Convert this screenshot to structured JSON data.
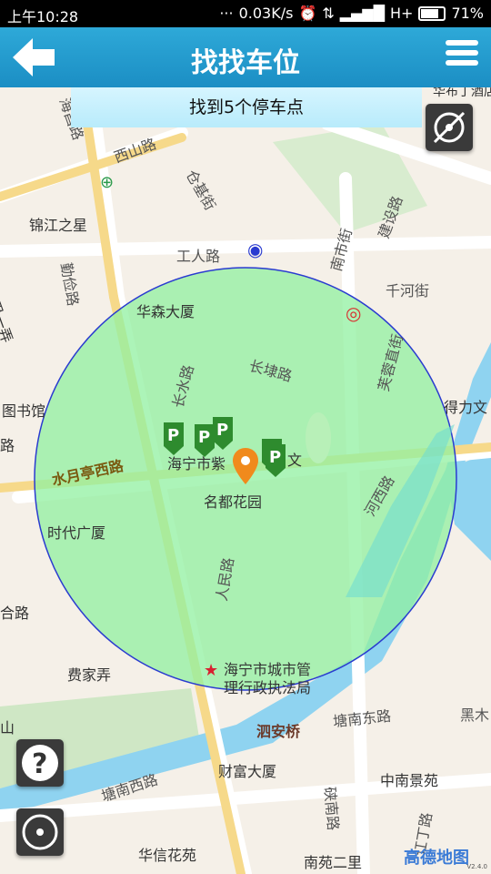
{
  "status": {
    "time": "上午10:28",
    "speed": "0.03K/s",
    "network": "H+",
    "battery": "71%",
    "battery_level": 0.71
  },
  "header": {
    "title": "找找车位"
  },
  "banner": {
    "text": "找到5个停车点"
  },
  "map_labels": {
    "jinjiang": "锦江之星",
    "huasen": "华森大厦",
    "library": "图书馆",
    "shidai": "时代广厦",
    "mingdu": "名都花园",
    "haining_zi": "海宁市紫",
    "wen": "文",
    "chengguan_1": "海宁市城市管",
    "chengguan_2": "理行政执法局",
    "delijwen": "得力文",
    "huafu": "华布丁酒店",
    "caifu": "财富大厦",
    "zhongnan": "中南景苑",
    "huaxin": "华信花苑",
    "nanyuan": "南苑二里",
    "fei": "费家弄",
    "siqiao": "泗安桥",
    "shan": "山",
    "hmu": "合路",
    "lu": "路",
    "yongfu": "永福里一弄"
  },
  "road_labels": {
    "xishan": "西山路",
    "haichang": "海昌路",
    "cangji": "仓基街",
    "jianshe": "建设路",
    "gongren": "工人路",
    "nanshi": "南市街",
    "qianhe": "千河街",
    "qinjian": "勤俭路",
    "changdi": "长埭路",
    "changshui": "长水路",
    "furong": "芙蓉直街",
    "shuiyue": "水月亭西路",
    "hexi": "河西路",
    "renmin": "人民路",
    "tangnan_e": "塘南东路",
    "tangnan_w": "塘南西路",
    "tingnan": "硖南路",
    "heimu": "黑木",
    "jiading": "讧丁路"
  },
  "parking": {
    "icon": "parking-pin-icon",
    "count": 5,
    "color": "#2e8b2e"
  },
  "map_brand": "高德地图",
  "map_version": "V2.4.0",
  "colors": {
    "accent": "#1f9bd0",
    "circle_fill": "#90f0a0",
    "circle_stroke": "#2a3bd0",
    "water": "#8fd3f0"
  }
}
